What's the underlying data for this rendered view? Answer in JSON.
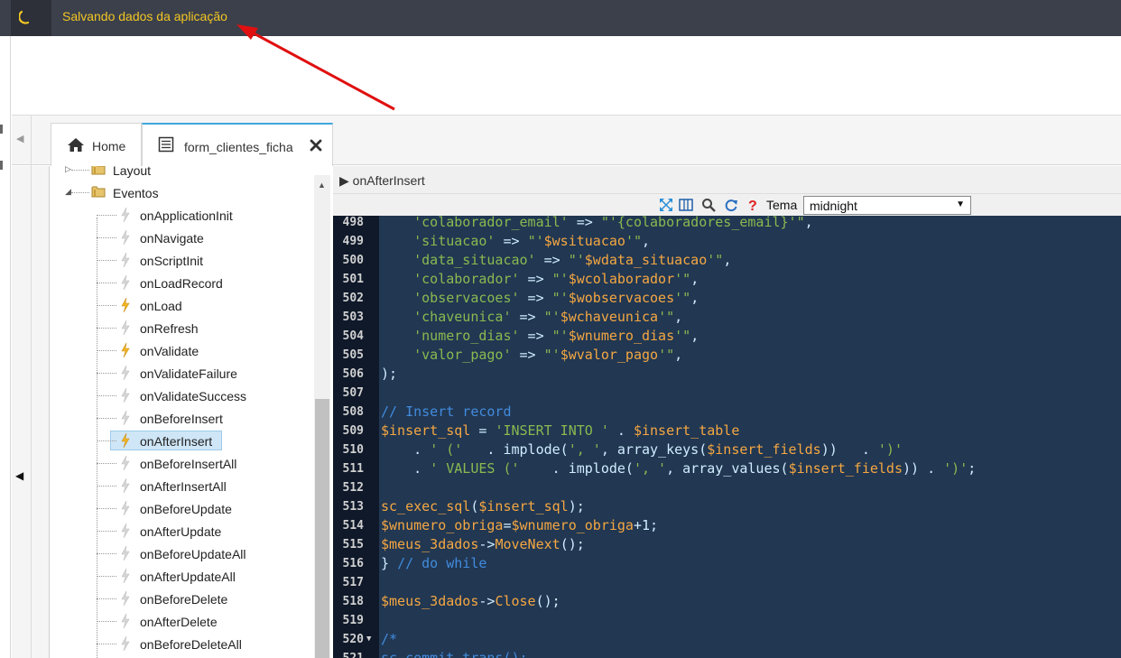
{
  "status_bar": {
    "message": "Salvando dados da aplicação",
    "accent": "#f3c623"
  },
  "tabs": [
    {
      "label": "Home",
      "icon": "home-icon"
    },
    {
      "label": "form_clientes_ficha",
      "icon": "form-doc-icon",
      "closable": true
    }
  ],
  "tree": {
    "folders": [
      {
        "label": "Layout",
        "expanded": false
      },
      {
        "label": "Eventos",
        "expanded": true
      }
    ],
    "events": [
      {
        "label": "onApplicationInit",
        "active": false
      },
      {
        "label": "onNavigate",
        "active": false
      },
      {
        "label": "onScriptInit",
        "active": false
      },
      {
        "label": "onLoadRecord",
        "active": false
      },
      {
        "label": "onLoad",
        "active": true
      },
      {
        "label": "onRefresh",
        "active": false
      },
      {
        "label": "onValidate",
        "active": true
      },
      {
        "label": "onValidateFailure",
        "active": false
      },
      {
        "label": "onValidateSuccess",
        "active": false
      },
      {
        "label": "onBeforeInsert",
        "active": false
      },
      {
        "label": "onAfterInsert",
        "active": true,
        "selected": true
      },
      {
        "label": "onBeforeInsertAll",
        "active": false
      },
      {
        "label": "onAfterInsertAll",
        "active": false
      },
      {
        "label": "onBeforeUpdate",
        "active": false
      },
      {
        "label": "onAfterUpdate",
        "active": false
      },
      {
        "label": "onBeforeUpdateAll",
        "active": false
      },
      {
        "label": "onAfterUpdateAll",
        "active": false
      },
      {
        "label": "onBeforeDelete",
        "active": false
      },
      {
        "label": "onAfterDelete",
        "active": false
      },
      {
        "label": "onBeforeDeleteAll",
        "active": false
      }
    ]
  },
  "editor": {
    "title": "onAfterInsert",
    "theme_label": "Tema",
    "theme_value": "midnight",
    "toolbar_icons": [
      "fullscreen-icon",
      "columns-icon",
      "search-icon",
      "refresh-icon",
      "help-icon"
    ],
    "lines": [
      {
        "num": "498",
        "parts": [
          [
            "plain",
            "    "
          ],
          [
            "str",
            "'colaborador_email'"
          ],
          [
            "op",
            " => "
          ],
          [
            "str",
            "\"'{colaboradores_email}'\""
          ],
          [
            "op",
            ","
          ]
        ]
      },
      {
        "num": "499",
        "parts": [
          [
            "plain",
            "    "
          ],
          [
            "str",
            "'situacao'"
          ],
          [
            "op",
            " => "
          ],
          [
            "str",
            "\"'"
          ],
          [
            "var",
            "$wsituacao"
          ],
          [
            "str",
            "'\""
          ],
          [
            "op",
            ","
          ]
        ]
      },
      {
        "num": "500",
        "parts": [
          [
            "plain",
            "    "
          ],
          [
            "str",
            "'data_situacao'"
          ],
          [
            "op",
            " => "
          ],
          [
            "str",
            "\"'"
          ],
          [
            "var",
            "$wdata_situacao"
          ],
          [
            "str",
            "'\""
          ],
          [
            "op",
            ","
          ]
        ]
      },
      {
        "num": "501",
        "parts": [
          [
            "plain",
            "    "
          ],
          [
            "str",
            "'colaborador'"
          ],
          [
            "op",
            " => "
          ],
          [
            "str",
            "\"'"
          ],
          [
            "var",
            "$wcolaborador"
          ],
          [
            "str",
            "'\""
          ],
          [
            "op",
            ","
          ]
        ]
      },
      {
        "num": "502",
        "parts": [
          [
            "plain",
            "    "
          ],
          [
            "str",
            "'observacoes'"
          ],
          [
            "op",
            " => "
          ],
          [
            "str",
            "\"'"
          ],
          [
            "var",
            "$wobservacoes"
          ],
          [
            "str",
            "'\""
          ],
          [
            "op",
            ","
          ]
        ]
      },
      {
        "num": "503",
        "parts": [
          [
            "plain",
            "    "
          ],
          [
            "str",
            "'chaveunica'"
          ],
          [
            "op",
            " => "
          ],
          [
            "str",
            "\"'"
          ],
          [
            "var",
            "$wchaveunica"
          ],
          [
            "str",
            "'\""
          ],
          [
            "op",
            ","
          ]
        ]
      },
      {
        "num": "504",
        "parts": [
          [
            "plain",
            "    "
          ],
          [
            "str",
            "'numero_dias'"
          ],
          [
            "op",
            " => "
          ],
          [
            "str",
            "\"'"
          ],
          [
            "var",
            "$wnumero_dias"
          ],
          [
            "str",
            "'\""
          ],
          [
            "op",
            ","
          ]
        ]
      },
      {
        "num": "505",
        "parts": [
          [
            "plain",
            "    "
          ],
          [
            "str",
            "'valor_pago'"
          ],
          [
            "op",
            " => "
          ],
          [
            "str",
            "\"'"
          ],
          [
            "var",
            "$wvalor_pago"
          ],
          [
            "str",
            "'\""
          ],
          [
            "op",
            ","
          ]
        ]
      },
      {
        "num": "506",
        "parts": [
          [
            "op",
            ");"
          ]
        ]
      },
      {
        "num": "507",
        "parts": []
      },
      {
        "num": "508",
        "parts": [
          [
            "com",
            "// Insert record"
          ]
        ]
      },
      {
        "num": "509",
        "parts": [
          [
            "var",
            "$insert_sql"
          ],
          [
            "op",
            " = "
          ],
          [
            "str",
            "'INSERT INTO '"
          ],
          [
            "op",
            " . "
          ],
          [
            "var",
            "$insert_table"
          ]
        ]
      },
      {
        "num": "510",
        "parts": [
          [
            "op",
            "    . "
          ],
          [
            "str",
            "' ('"
          ],
          [
            "op",
            "   . implode("
          ],
          [
            "str",
            "', '"
          ],
          [
            "op",
            ", array_keys("
          ],
          [
            "var",
            "$insert_fields"
          ],
          [
            "op",
            "))   . "
          ],
          [
            "str",
            "')'"
          ]
        ]
      },
      {
        "num": "511",
        "parts": [
          [
            "op",
            "    . "
          ],
          [
            "str",
            "' VALUES ('"
          ],
          [
            "op",
            "    . implode("
          ],
          [
            "str",
            "', '"
          ],
          [
            "op",
            ", array_values("
          ],
          [
            "var",
            "$insert_fields"
          ],
          [
            "op",
            ")) . "
          ],
          [
            "str",
            "')'"
          ],
          [
            "op",
            ";"
          ]
        ]
      },
      {
        "num": "512",
        "parts": []
      },
      {
        "num": "513",
        "parts": [
          [
            "fn",
            "sc_exec_sql"
          ],
          [
            "op",
            "("
          ],
          [
            "var",
            "$insert_sql"
          ],
          [
            "op",
            ");"
          ]
        ]
      },
      {
        "num": "514",
        "parts": [
          [
            "var",
            "$wnumero_obriga"
          ],
          [
            "op",
            "="
          ],
          [
            "var",
            "$wnumero_obriga"
          ],
          [
            "op",
            "+1;"
          ]
        ]
      },
      {
        "num": "515",
        "parts": [
          [
            "var",
            "$meus_3dados"
          ],
          [
            "op",
            "->"
          ],
          [
            "fn",
            "MoveNext"
          ],
          [
            "op",
            "();"
          ]
        ]
      },
      {
        "num": "516",
        "parts": [
          [
            "op",
            "} "
          ],
          [
            "com",
            "// do while"
          ]
        ]
      },
      {
        "num": "517",
        "parts": []
      },
      {
        "num": "518",
        "parts": [
          [
            "var",
            "$meus_3dados"
          ],
          [
            "op",
            "->"
          ],
          [
            "fn",
            "Close"
          ],
          [
            "op",
            "();"
          ]
        ]
      },
      {
        "num": "519",
        "parts": []
      },
      {
        "num": "520",
        "fold": true,
        "parts": [
          [
            "com",
            "/*"
          ]
        ]
      },
      {
        "num": "521",
        "parts": [
          [
            "com",
            "sc_commit_trans();"
          ]
        ]
      }
    ]
  }
}
